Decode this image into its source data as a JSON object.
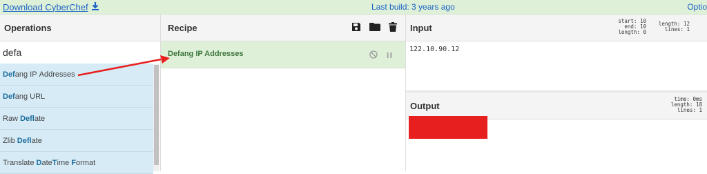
{
  "topbar": {
    "download_label": "Download CyberChef",
    "build_label": "Last build: 3 years ago",
    "options_label": "Optio"
  },
  "operations": {
    "title": "Operations",
    "search_value": "defa",
    "items": [
      "Defang IP Addresses",
      "Defang URL",
      "Raw Deflate",
      "Zlib Deflate",
      "Translate DateTime Format"
    ]
  },
  "recipe": {
    "title": "Recipe",
    "ops": [
      "Defang IP Addresses"
    ]
  },
  "input": {
    "title": "Input",
    "value": "122.10.90.12",
    "stats": {
      "start_label": "start:",
      "start": "10",
      "end_label": "end:",
      "end": "10",
      "length_label": "length:",
      "length_sel": "0",
      "length2_label": "length:",
      "length": "12",
      "lines_label": "lines:",
      "lines": "1"
    }
  },
  "output": {
    "title": "Output",
    "stats": {
      "time_label": "time:",
      "time": "0ms",
      "length_label": "length:",
      "length": "18",
      "lines_label": "lines:",
      "lines": "1"
    }
  },
  "colors": {
    "green_bg": "#dff0d8",
    "blue_item": "#d6ebf6",
    "link": "#1a63c5",
    "redaction": "#e81f1f",
    "arrow": "#e81f1f"
  }
}
